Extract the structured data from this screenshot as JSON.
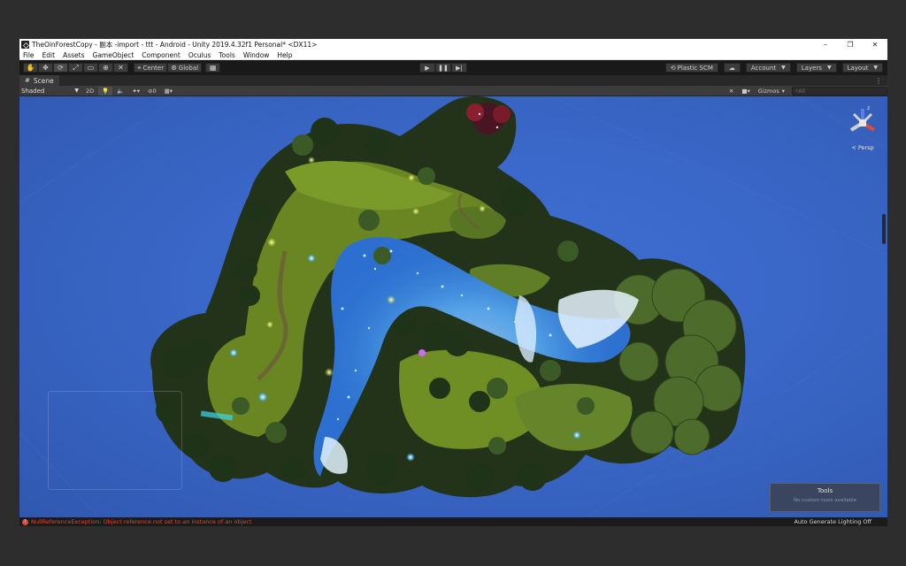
{
  "window": {
    "title": "TheOinForestCopy - 副本 -import - ttt - Android - Unity 2019.4.32f1 Personal* <DX11>",
    "controls": [
      "–",
      "❐",
      "✕"
    ]
  },
  "menu": [
    "File",
    "Edit",
    "Assets",
    "GameObject",
    "Component",
    "Oculus",
    "Tools",
    "Window",
    "Help"
  ],
  "toolbar": {
    "tools": [
      "hand-tool-icon",
      "move-tool-icon",
      "rotate-tool-icon",
      "scale-tool-icon",
      "rect-tool-icon",
      "transform-tool-icon",
      "custom-tool-icon"
    ],
    "pivot_mode": "Center",
    "pivot_rotation": "Global",
    "plastic_scm": "Plastic SCM",
    "account": "Account",
    "layers": "Layers",
    "layout": "Layout"
  },
  "tab": {
    "label": "Scene"
  },
  "scene_toolbar": {
    "shading": "Shaded",
    "mode_2d": "2D",
    "hidden_count": "0",
    "gizmos": "Gizmos",
    "search_placeholder": "All"
  },
  "viewport": {
    "projection": "Persp",
    "tools_panel_title": "Tools",
    "tools_panel_subtitle": "No custom tools available"
  },
  "status": {
    "error": "NullReferenceException: Object reference not set to an instance of an object",
    "right": "Auto Generate Lighting Off"
  },
  "colors": {
    "viewport_bg": "#3a67c8",
    "grass": "#6f8a24",
    "foliage": "#2f4a1c",
    "water_glow": "#7fd7ff",
    "error": "#e0462e"
  }
}
